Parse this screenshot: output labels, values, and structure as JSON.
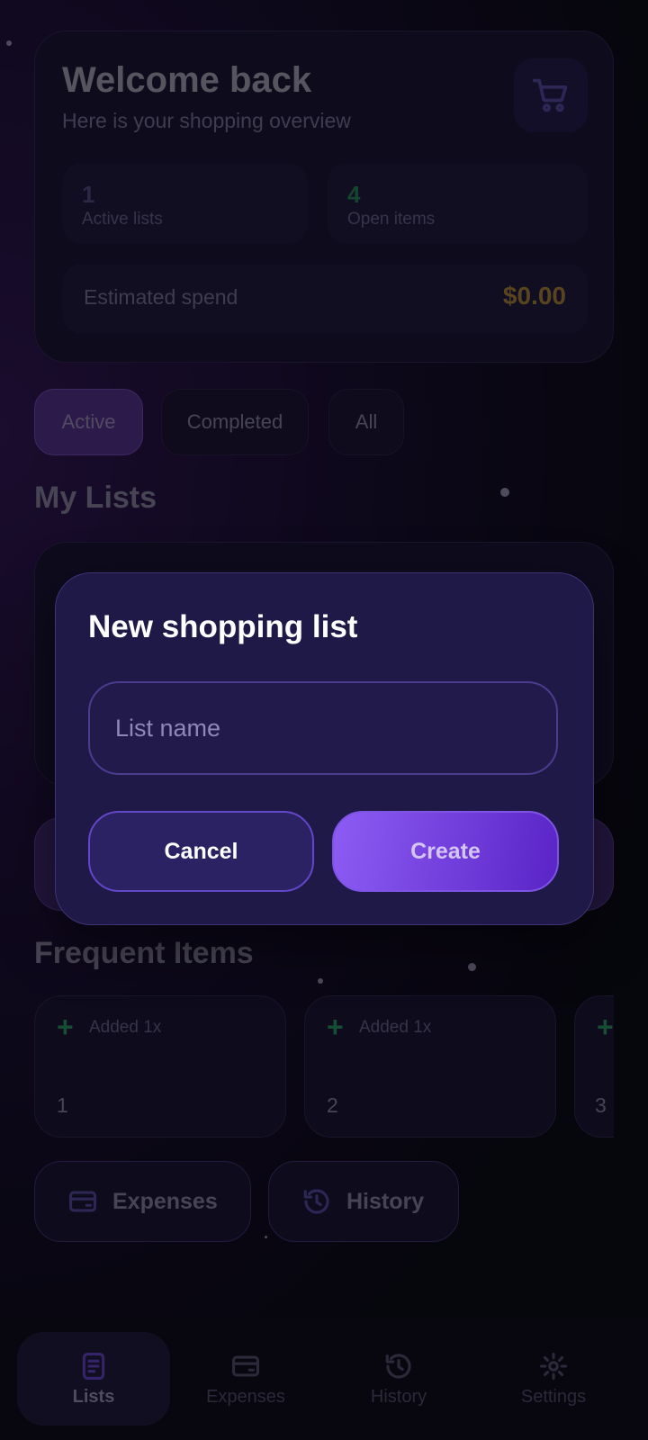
{
  "overview": {
    "title": "Welcome back",
    "subtitle": "Here is your shopping overview",
    "active_lists_value": "1",
    "active_lists_label": "Active lists",
    "open_items_value": "4",
    "open_items_label": "Open items",
    "spend_label": "Estimated spend",
    "spend_value": "$0.00"
  },
  "filters": [
    "Active",
    "Completed",
    "All"
  ],
  "sections": {
    "my_lists": "My Lists",
    "frequent_items": "Frequent Items"
  },
  "frequent_items": [
    {
      "added": "Added 1x",
      "name": "1"
    },
    {
      "added": "Added 1x",
      "name": "2"
    },
    {
      "added": "",
      "name": "3"
    }
  ],
  "quick_actions": {
    "expenses": "Expenses",
    "history": "History"
  },
  "bottom_nav": [
    "Lists",
    "Expenses",
    "History",
    "Settings"
  ],
  "modal": {
    "title": "New shopping list",
    "input_placeholder": "List name",
    "input_value": "",
    "cancel_label": "Cancel",
    "create_label": "Create"
  },
  "colors": {
    "accent": "#8d5cf4",
    "active_lists_color": "#4a4476",
    "open_items_color": "#1f7a4c",
    "spend_color": "#9c7a2e",
    "plus_color": "#238a55"
  }
}
